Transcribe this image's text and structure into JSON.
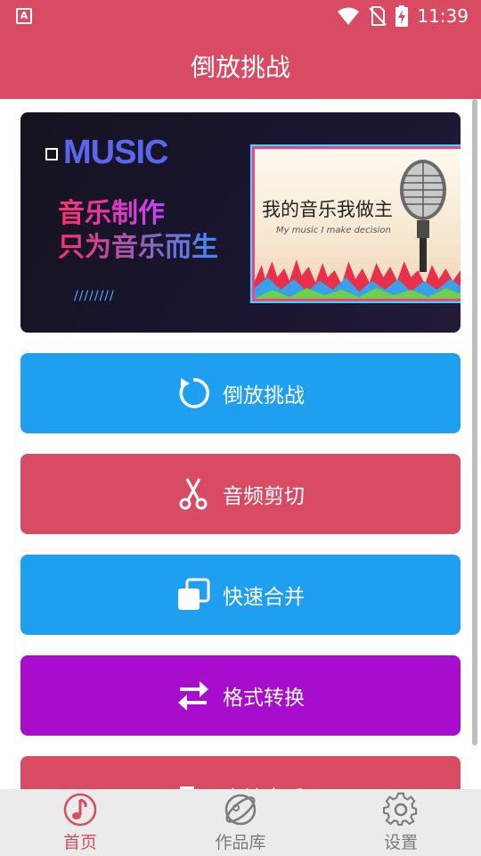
{
  "status_bar": {
    "time": "11:39",
    "app_icon_letter": "A"
  },
  "app_bar": {
    "title": "倒放挑战"
  },
  "banner": {
    "brand": "MUSIC",
    "line1": "音乐制作",
    "line2": "只为音乐而生",
    "slashes": "////////",
    "photo_title": "我的音乐我做主",
    "photo_subtitle": "My music I make decision"
  },
  "actions": [
    {
      "label": "倒放挑战",
      "icon": "reverse-icon",
      "color": "#1e9ff0"
    },
    {
      "label": "音频剪切",
      "icon": "scissors-icon",
      "color": "#d94a63"
    },
    {
      "label": "快速合并",
      "icon": "merge-icon",
      "color": "#1e9ff0"
    },
    {
      "label": "格式转换",
      "icon": "convert-icon",
      "color": "#a80ccc"
    },
    {
      "label": "本地音乐",
      "icon": "local-music-icon",
      "color": "#d94a63"
    }
  ],
  "tabs": [
    {
      "label": "首页",
      "icon": "music-note-icon",
      "active": true
    },
    {
      "label": "作品库",
      "icon": "works-icon",
      "active": false
    },
    {
      "label": "设置",
      "icon": "gear-icon",
      "active": false
    }
  ],
  "colors": {
    "primary": "#d94a63",
    "blue": "#1e9ff0",
    "purple": "#a80ccc",
    "tabbar": "#ebebeb"
  }
}
